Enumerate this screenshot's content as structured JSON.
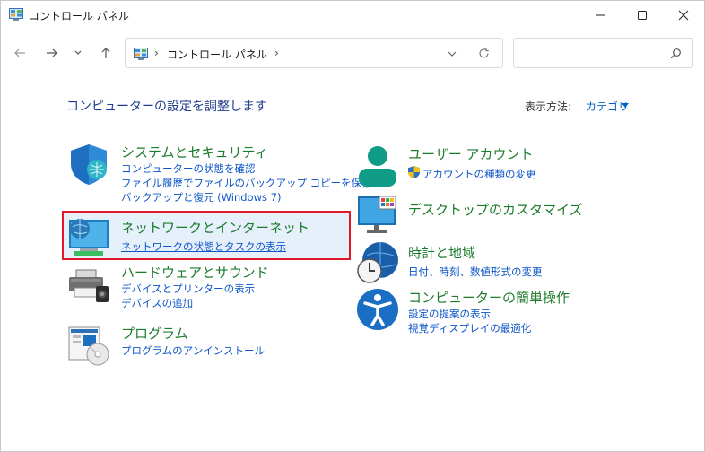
{
  "window": {
    "title": "コントロール パネル"
  },
  "address": {
    "breadcrumb": "コントロール パネル",
    "separator": "›"
  },
  "search": {
    "placeholder": ""
  },
  "content": {
    "page_title": "コンピューターの設定を調整します",
    "view_by_label": "表示方法:",
    "view_by_value": "カテゴリ"
  },
  "categories": {
    "system": {
      "title": "システムとセキュリティ",
      "links": [
        "コンピューターの状態を確認",
        "ファイル履歴でファイルのバックアップ コピーを保存",
        "バックアップと復元 (Windows 7)"
      ]
    },
    "network": {
      "title": "ネットワークとインターネット",
      "links": [
        "ネットワークの状態とタスクの表示"
      ]
    },
    "hardware": {
      "title": "ハードウェアとサウンド",
      "links": [
        "デバイスとプリンターの表示",
        "デバイスの追加"
      ]
    },
    "programs": {
      "title": "プログラム",
      "links": [
        "プログラムのアンインストール"
      ]
    },
    "user_accounts": {
      "title": "ユーザー アカウント",
      "links": [
        "アカウントの種類の変更"
      ]
    },
    "appearance": {
      "title": "デスクトップのカスタマイズ",
      "links": []
    },
    "clock": {
      "title": "時計と地域",
      "links": [
        "日付、時刻、数値形式の変更"
      ]
    },
    "ease": {
      "title": "コンピューターの簡単操作",
      "links": [
        "設定の提案の表示",
        "視覚ディスプレイの最適化"
      ]
    }
  },
  "colors": {
    "category_title": "#1d7b2c",
    "link": "#0d55c8",
    "page_title": "#1e3b8c",
    "highlight_border": "#e0192a"
  }
}
